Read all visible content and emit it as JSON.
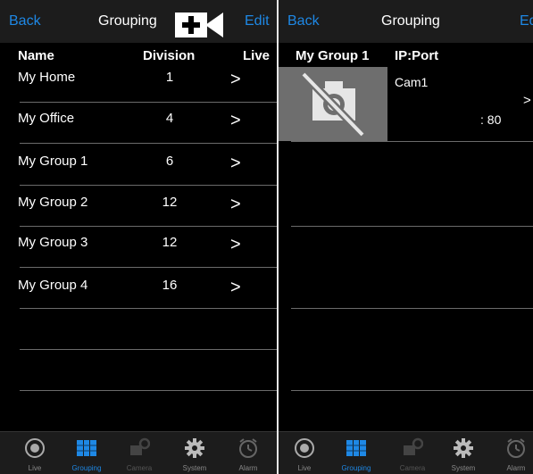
{
  "left": {
    "nav": {
      "back": "Back",
      "title": "Grouping",
      "edit": "Edit"
    },
    "headers": {
      "name": "Name",
      "division": "Division",
      "live": "Live"
    },
    "groups": [
      {
        "name": "My Home",
        "division": "1",
        "chevron": ">"
      },
      {
        "name": "My Office",
        "division": "4",
        "chevron": ">"
      },
      {
        "name": "My Group 1",
        "division": "6",
        "chevron": ">"
      },
      {
        "name": "My Group 2",
        "division": "12",
        "chevron": ">"
      },
      {
        "name": "My Group 3",
        "division": "12",
        "chevron": ">"
      },
      {
        "name": "My Group 4",
        "division": "16",
        "chevron": ">"
      }
    ]
  },
  "right": {
    "nav": {
      "back": "Back",
      "title": "Grouping",
      "edit": "Edi"
    },
    "headers": {
      "group": "My Group 1",
      "ipport": "IP:Port"
    },
    "cameras": [
      {
        "name": "Cam1",
        "port": ": 80",
        "chevron": ">"
      }
    ]
  },
  "tabbar": {
    "active_color": "#1e88e5",
    "tabs": [
      {
        "label": "Live",
        "icon": "live-icon",
        "state": "normal"
      },
      {
        "label": "Grouping",
        "icon": "grouping-icon",
        "state": "active"
      },
      {
        "label": "Camera",
        "icon": "camera-icon",
        "state": "disabled"
      },
      {
        "label": "System",
        "icon": "gear-icon",
        "state": "normal"
      },
      {
        "label": "Alarm",
        "icon": "alarm-icon",
        "state": "normal"
      }
    ]
  }
}
